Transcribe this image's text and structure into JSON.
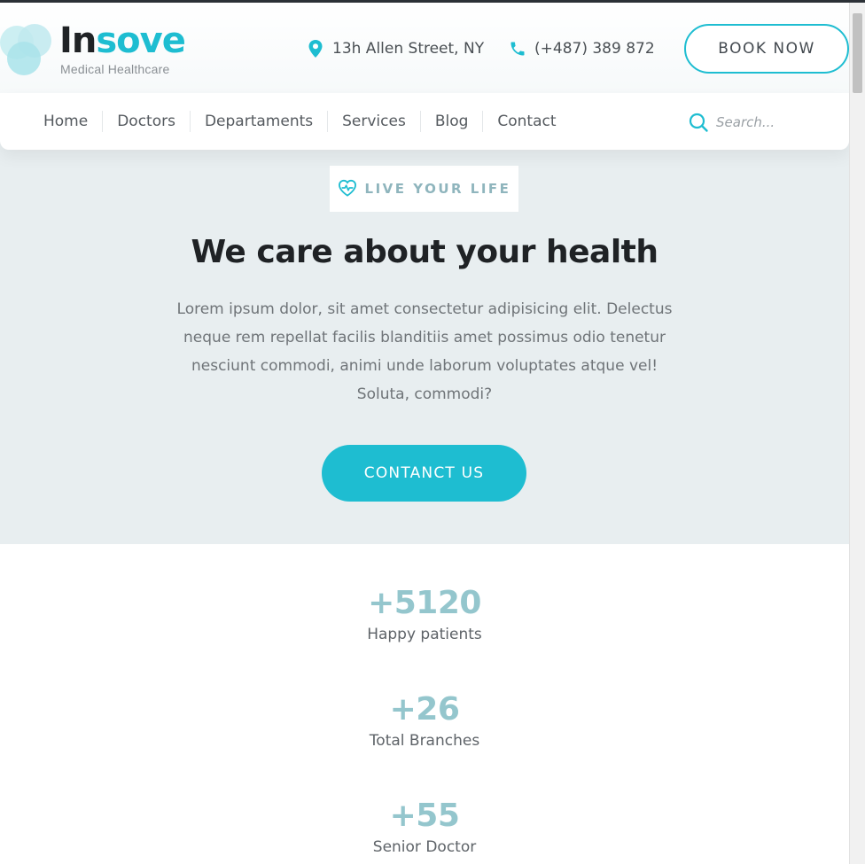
{
  "brand": {
    "name_part1": "In",
    "name_part2": "sove",
    "tagline": "Medical Healthcare",
    "accent_color": "#1ebdd1"
  },
  "header": {
    "address": "13h Allen Street, NY",
    "phone": "(+487) 389 872",
    "book_button": "BOOK NOW",
    "address_icon": "map-pin-icon",
    "phone_icon": "phone-icon"
  },
  "nav": {
    "items": [
      {
        "label": "Home"
      },
      {
        "label": "Doctors"
      },
      {
        "label": "Departaments"
      },
      {
        "label": "Services"
      },
      {
        "label": "Blog"
      },
      {
        "label": "Contact"
      }
    ],
    "search": {
      "placeholder": "Search...",
      "icon": "search-icon"
    }
  },
  "hero": {
    "tag": "LIVE YOUR LIFE",
    "tag_icon": "heart-pulse-icon",
    "title": "We care about your health",
    "text": "Lorem ipsum dolor, sit amet consectetur adipisicing elit. Delectus neque rem repellat facilis blanditiis amet possimus odio tenetur nesciunt commodi, animi unde laborum voluptates atque vel! Soluta, commodi?",
    "cta": "CONTANCT US",
    "background_color": "#e8eef0"
  },
  "stats": [
    {
      "number": "+5120",
      "label": "Happy patients"
    },
    {
      "number": "+26",
      "label": "Total Branches"
    },
    {
      "number": "+55",
      "label": "Senior Doctor"
    }
  ]
}
